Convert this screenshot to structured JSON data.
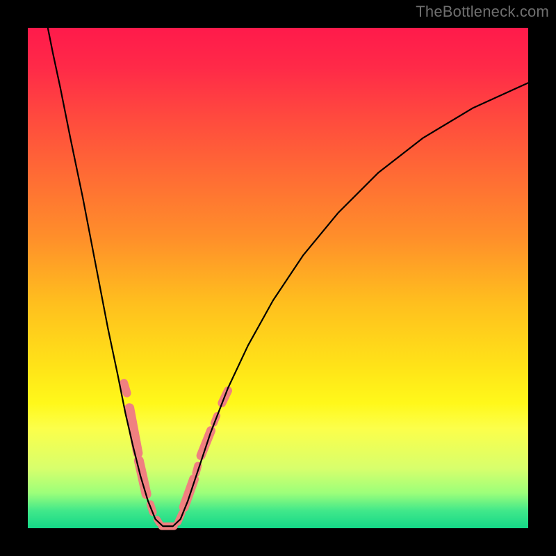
{
  "watermark": "TheBottleneck.com",
  "chart_data": {
    "type": "line",
    "title": "",
    "xlabel": "",
    "ylabel": "",
    "xlim": [
      0,
      100
    ],
    "ylim": [
      0,
      100
    ],
    "grid": false,
    "legend": false,
    "background_gradient_stops": [
      {
        "offset": 0.0,
        "color": "#ff1a4b"
      },
      {
        "offset": 0.08,
        "color": "#ff2a48"
      },
      {
        "offset": 0.18,
        "color": "#ff4a3e"
      },
      {
        "offset": 0.3,
        "color": "#ff6d34"
      },
      {
        "offset": 0.42,
        "color": "#ff8f2a"
      },
      {
        "offset": 0.55,
        "color": "#ffbf1e"
      },
      {
        "offset": 0.68,
        "color": "#ffe418"
      },
      {
        "offset": 0.75,
        "color": "#fff81a"
      },
      {
        "offset": 0.8,
        "color": "#fcff4a"
      },
      {
        "offset": 0.88,
        "color": "#d8ff6c"
      },
      {
        "offset": 0.93,
        "color": "#9cff7a"
      },
      {
        "offset": 0.965,
        "color": "#41e88a"
      },
      {
        "offset": 1.0,
        "color": "#14d888"
      }
    ],
    "series": [
      {
        "name": "curve",
        "color": "#000000",
        "stroke_width": 2.2,
        "data": [
          {
            "x": 4.0,
            "y": 100.0
          },
          {
            "x": 5.0,
            "y": 95.0
          },
          {
            "x": 6.5,
            "y": 88.0
          },
          {
            "x": 8.5,
            "y": 78.0
          },
          {
            "x": 11.0,
            "y": 66.0
          },
          {
            "x": 13.5,
            "y": 53.0
          },
          {
            "x": 16.0,
            "y": 40.0
          },
          {
            "x": 18.0,
            "y": 30.5
          },
          {
            "x": 19.5,
            "y": 23.0
          },
          {
            "x": 21.0,
            "y": 16.5
          },
          {
            "x": 22.5,
            "y": 10.5
          },
          {
            "x": 24.0,
            "y": 5.5
          },
          {
            "x": 25.5,
            "y": 1.8
          },
          {
            "x": 27.0,
            "y": 0.4
          },
          {
            "x": 29.0,
            "y": 0.4
          },
          {
            "x": 30.5,
            "y": 1.8
          },
          {
            "x": 32.0,
            "y": 5.5
          },
          {
            "x": 34.0,
            "y": 11.5
          },
          {
            "x": 36.5,
            "y": 19.0
          },
          {
            "x": 40.0,
            "y": 28.0
          },
          {
            "x": 44.0,
            "y": 36.5
          },
          {
            "x": 49.0,
            "y": 45.5
          },
          {
            "x": 55.0,
            "y": 54.5
          },
          {
            "x": 62.0,
            "y": 63.0
          },
          {
            "x": 70.0,
            "y": 71.0
          },
          {
            "x": 79.0,
            "y": 78.0
          },
          {
            "x": 89.0,
            "y": 84.0
          },
          {
            "x": 100.0,
            "y": 89.0
          }
        ]
      },
      {
        "name": "marker-capsules",
        "color": "#f08080",
        "type": "capsule",
        "data": [
          {
            "x1": 19.2,
            "y1": 29.0,
            "x2": 19.8,
            "y2": 27.0,
            "w": 12
          },
          {
            "x1": 20.3,
            "y1": 24.0,
            "x2": 22.0,
            "y2": 15.0,
            "w": 14
          },
          {
            "x1": 22.2,
            "y1": 13.5,
            "x2": 23.7,
            "y2": 6.8,
            "w": 14
          },
          {
            "x1": 24.5,
            "y1": 4.8,
            "x2": 25.0,
            "y2": 3.2,
            "w": 11
          },
          {
            "x1": 25.8,
            "y1": 1.8,
            "x2": 26.3,
            "y2": 1.0,
            "w": 10
          },
          {
            "x1": 26.8,
            "y1": 0.4,
            "x2": 29.2,
            "y2": 0.4,
            "w": 11
          },
          {
            "x1": 30.0,
            "y1": 1.2,
            "x2": 30.8,
            "y2": 3.0,
            "w": 10
          },
          {
            "x1": 31.2,
            "y1": 4.2,
            "x2": 33.2,
            "y2": 9.8,
            "w": 14
          },
          {
            "x1": 33.6,
            "y1": 11.0,
            "x2": 34.0,
            "y2": 12.5,
            "w": 11
          },
          {
            "x1": 34.6,
            "y1": 14.5,
            "x2": 36.6,
            "y2": 19.5,
            "w": 13
          },
          {
            "x1": 37.2,
            "y1": 21.0,
            "x2": 37.8,
            "y2": 22.5,
            "w": 10
          },
          {
            "x1": 38.8,
            "y1": 25.0,
            "x2": 40.0,
            "y2": 27.5,
            "w": 12
          }
        ]
      }
    ]
  }
}
